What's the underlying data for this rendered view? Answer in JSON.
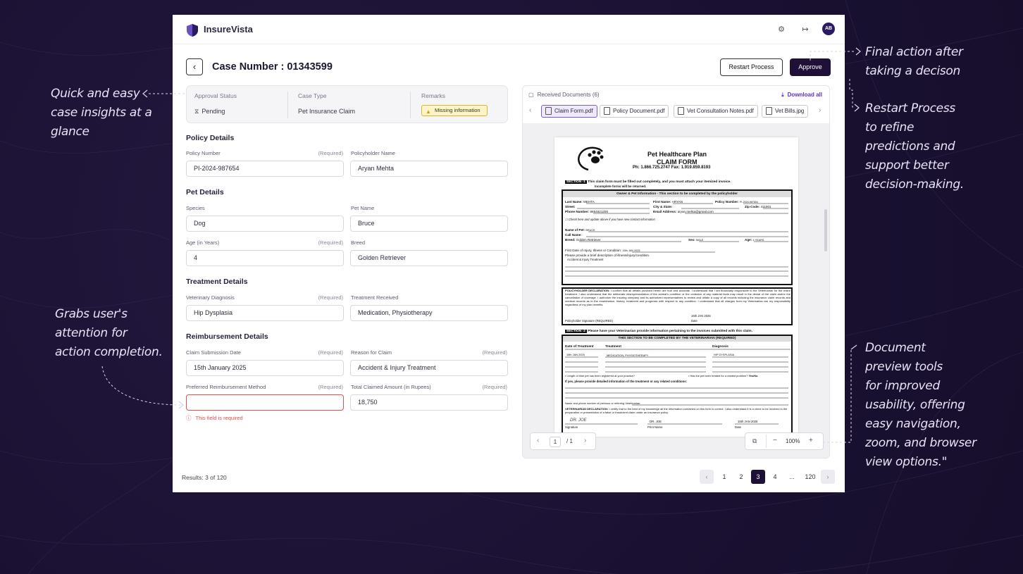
{
  "app": {
    "name": "InsureVista",
    "avatar_initials": "AB"
  },
  "case": {
    "title": "Case Number : 01343599",
    "restart_label": "Restart Process",
    "approve_label": "Approve"
  },
  "status": {
    "approval_label": "Approval Status",
    "approval_value": "Pending",
    "type_label": "Case Type",
    "type_value": "Pet Insurance Claim",
    "remarks_label": "Remarks",
    "remarks_value": "Missing information"
  },
  "sections": {
    "policy": "Policy Details",
    "pet": "Pet Details",
    "treatment": "Treatment Details",
    "reimbursement": "Reimbursement Details"
  },
  "required_text": "(Required)",
  "fields": {
    "policy_number": {
      "label": "Policy Number",
      "value": "PI-2024-987654"
    },
    "holder_name": {
      "label": "Policyholder Name",
      "value": "Aryan Mehta"
    },
    "species": {
      "label": "Species",
      "value": "Dog"
    },
    "pet_name": {
      "label": "Pet Name",
      "value": "Bruce"
    },
    "age": {
      "label": "Age (in Years)",
      "value": "4"
    },
    "breed": {
      "label": "Breed",
      "value": "Golden Retriever"
    },
    "diagnosis": {
      "label": "Veterinary Diagnosis",
      "value": "Hip Dysplasia"
    },
    "treatment": {
      "label": "Treatment Received",
      "value": "Medication, Physiotherapy"
    },
    "submission_date": {
      "label": "Claim Submission Date",
      "value": "15th January 2025"
    },
    "reason": {
      "label": "Reason for Claim",
      "value": "Accident & Injury Treatment"
    },
    "method": {
      "label": "Preferred Reimbursement Method",
      "value": ""
    },
    "amount": {
      "label": "Total Claimed Amount (in Rupees)",
      "value": "18,750"
    }
  },
  "error_message": "This field is required",
  "results": "Results: 3 of 120",
  "pagination": {
    "pages": [
      "1",
      "2",
      "3",
      "4",
      "...",
      "120"
    ],
    "current": "3"
  },
  "documents": {
    "header": "Received Documents (6)",
    "download_all": "Download all",
    "tabs": [
      "Claim Form.pdf",
      "Policy Document.pdf",
      "Vet Consultation Notes.pdf",
      "Vet Bills.jpg"
    ],
    "page_input": "1",
    "page_total": "/ 1",
    "zoom": "100%"
  },
  "claim_form": {
    "plan_title": "Pet Healthcare Plan",
    "form_title": "CLAIM FORM",
    "phone_fax": "Ph: 1.866.725.2747  Fax: 1.919.859.8193",
    "section1_tag": "SECTION -1",
    "section1_text": "This claim form must be filled out completely, and you must attach your itemized invoice.",
    "section1_sub": "Incomplete forms will be returned.",
    "owner_bar": "Owner & Pet Information - This section to be completed by the policyholder",
    "last_name": "Last Name:",
    "last_name_val": "MEHTA",
    "first_name": "First Name:",
    "first_name_val": "ARYAN",
    "policy_no": "Policy Number:",
    "policy_no_val": "PI-2024-987654",
    "street": "Street:",
    "city": "City & State:",
    "zip": "Zip Code:",
    "zip_val": "411001",
    "phone": "Phone Number:",
    "phone_val": "9854621200",
    "email": "Email Address:",
    "email_val": "aryan.mehta@gmail.com",
    "check_text": "Check here and update above if you have new contact information",
    "name_of_pet": "Name of Pet:",
    "name_of_pet_val": "BRUCE",
    "call_name": "Call Name:",
    "breed": "Breed:",
    "breed_val": "Golden Retriever",
    "sex": "Sex:",
    "sex_val": "MALE",
    "age": "Age:",
    "age_val": "4 YEARS",
    "first_date": "First Date of Injury, Illness or Condition:",
    "first_date_val": "15th JAN 2025",
    "describe": "Please provide a brief description of illness/injury/condition.",
    "describe_val": "Accident & Injury Treatment",
    "declaration_title": "POLICYHOLDER DECLARATION:",
    "declaration_text": "I confirm that all details provided herein are true and accurate. I understand that I am financially responsible to the Veterinarian for the entire treatment. I also understand that the deliberate misrepresentation of the animal's condition or the omission of any material facts may result in the denial of the claim and/or the cancellation of coverage. I authorize the insuring company and its authorized representatives to review and obtain a copy of all records including the insurance claim records and medical records as to the examination, history, treatment and prognosis with respect to any condition. I understand that all charges from my Veterinarian are my responsibility regardless of my plan benefits.",
    "signature_label": "Policyholder Signature (REQUIRED)",
    "date_label": "Date",
    "date_val": "15th JAN 2025",
    "section2_tag": "SECTION -2",
    "section2_text": "Please have your Veterinarian provide information pertaining to the invoices submitted with this claim.",
    "vet_bar": "THIS SECTION TO BE COMPLETED BY THE VETERINARIAN (REQUIRED)",
    "col_date": "Date of Treatment",
    "col_treatment": "Treatment",
    "col_diagnosis": "Diagnosis",
    "row_date": "15th JAN 2025",
    "row_treatment": "MEDICATION, PHYSIOTHERAPY",
    "row_diagnosis": "HIP DYSPLASIA",
    "length_q": "• Length of time pet has been registered at your practice?",
    "treated_q": "• Has the pet been treated for a related problem?",
    "yes_no": "Yes/No",
    "if_yes": "If yes, please provide detailed information of the treatment or any related conditions:",
    "prev_vet": "Name and phone number of previous or referring Veterinarian:",
    "vet_decl_title": "VETERINARIAN DECLARATION:",
    "vet_decl_text": "I certify that to the best of my knowledge all the information contained on this form is correct. I also understand it is a crime to be involved in the preparation or presentation of a false or fraudulent claim under an insurance policy.",
    "vet_sig": "DR. JOE",
    "vet_print": "DR. JOE",
    "vet_date": "15th JAN 2025",
    "sig_label": "Signature",
    "print_label": "Print Name",
    "date_label2": "Date"
  },
  "annotations": {
    "final_action": [
      "Final action after",
      "taking a decison"
    ],
    "restart": [
      "Restart Process",
      "to refine",
      "predictions and",
      "support better",
      "decision-making."
    ],
    "insights": [
      "Quick and easy",
      "case insights at a",
      "glance"
    ],
    "attention": [
      "Grabs user's",
      "attention for",
      "action completion."
    ],
    "preview": [
      "Document",
      "preview tools",
      "for improved",
      "usability, offering",
      "easy navigation,",
      "zoom, and browser",
      "view options.\""
    ]
  },
  "colors": {
    "background": "#1a1132",
    "primary": "#1e1036",
    "accent": "#5b2fc9",
    "error": "#d9534f",
    "warning_bg": "#fdf4c9"
  },
  "icons": [
    "shield-logo-icon",
    "gear-icon",
    "logout-icon",
    "back-arrow-icon",
    "hourglass-icon",
    "warning-icon",
    "document-icon",
    "download-icon",
    "file-icon",
    "image-icon",
    "chevron-left-icon",
    "chevron-right-icon",
    "external-link-icon",
    "minus-icon",
    "plus-icon",
    "error-circle-icon",
    "paw-logo-icon"
  ]
}
